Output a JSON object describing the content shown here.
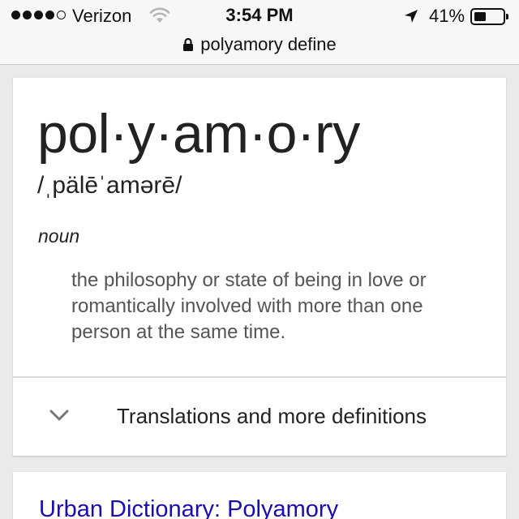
{
  "status_bar": {
    "carrier": "Verizon",
    "signal_bars_filled": 4,
    "signal_bars_total": 5,
    "time": "3:54 PM",
    "battery": "41%",
    "battery_level": 0.41,
    "icons": [
      "wifi-icon",
      "location-arrow-icon",
      "battery-icon"
    ]
  },
  "address_bar": {
    "query": "polyamory define",
    "icon": "lock-icon"
  },
  "definition": {
    "headword": "pol·y·am·o·ry",
    "pronunciation": "/ˌpälēˈamərē/",
    "part_of_speech": "noun",
    "meaning": "the philosophy or state of being in love or romantically involved with more than one person at the same time.",
    "more_label": "Translations and more definitions",
    "more_icon": "chevron-down-icon"
  },
  "results": [
    {
      "title": "Urban Dictionary: Polyamory"
    }
  ],
  "colors": {
    "page_background": "#eaeaea",
    "card_background": "#ffffff",
    "link": "#1a0dab",
    "definition_text": "#555555"
  }
}
